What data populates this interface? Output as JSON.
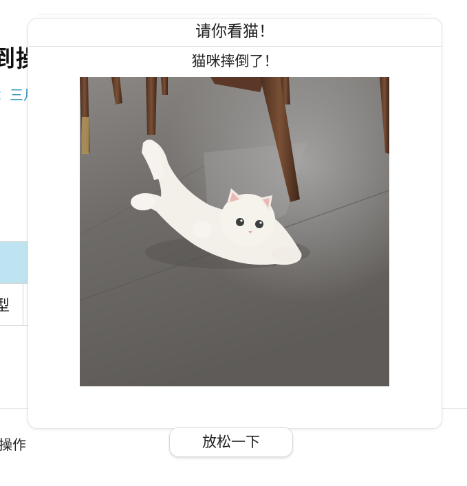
{
  "background": {
    "title_fragment": "到操",
    "subtitle_fragment": "：三月",
    "table_cell_fragment": "型",
    "operation_label_fragment": "操作"
  },
  "modal": {
    "header_title": "请你看猫！",
    "caption": "猫咪摔倒了！",
    "image_alt": "A white kitten lying on its back on a gray tiled floor under wooden chair legs"
  },
  "relax_button": {
    "label": "放松一下"
  },
  "colors": {
    "accent_link": "#3a9bbf",
    "table_header_bg": "#bfe4f1",
    "border": "#e3e3e3"
  }
}
